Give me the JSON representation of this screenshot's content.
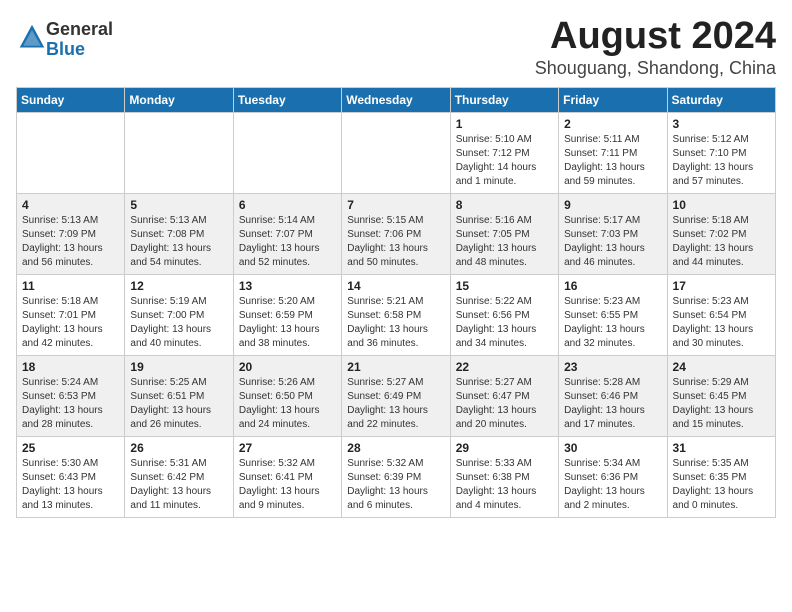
{
  "logo": {
    "general": "General",
    "blue": "Blue"
  },
  "title": "August 2024",
  "subtitle": "Shouguang, Shandong, China",
  "headers": [
    "Sunday",
    "Monday",
    "Tuesday",
    "Wednesday",
    "Thursday",
    "Friday",
    "Saturday"
  ],
  "weeks": [
    [
      {
        "day": "",
        "info": ""
      },
      {
        "day": "",
        "info": ""
      },
      {
        "day": "",
        "info": ""
      },
      {
        "day": "",
        "info": ""
      },
      {
        "day": "1",
        "info": "Sunrise: 5:10 AM\nSunset: 7:12 PM\nDaylight: 14 hours\nand 1 minute."
      },
      {
        "day": "2",
        "info": "Sunrise: 5:11 AM\nSunset: 7:11 PM\nDaylight: 13 hours\nand 59 minutes."
      },
      {
        "day": "3",
        "info": "Sunrise: 5:12 AM\nSunset: 7:10 PM\nDaylight: 13 hours\nand 57 minutes."
      }
    ],
    [
      {
        "day": "4",
        "info": "Sunrise: 5:13 AM\nSunset: 7:09 PM\nDaylight: 13 hours\nand 56 minutes."
      },
      {
        "day": "5",
        "info": "Sunrise: 5:13 AM\nSunset: 7:08 PM\nDaylight: 13 hours\nand 54 minutes."
      },
      {
        "day": "6",
        "info": "Sunrise: 5:14 AM\nSunset: 7:07 PM\nDaylight: 13 hours\nand 52 minutes."
      },
      {
        "day": "7",
        "info": "Sunrise: 5:15 AM\nSunset: 7:06 PM\nDaylight: 13 hours\nand 50 minutes."
      },
      {
        "day": "8",
        "info": "Sunrise: 5:16 AM\nSunset: 7:05 PM\nDaylight: 13 hours\nand 48 minutes."
      },
      {
        "day": "9",
        "info": "Sunrise: 5:17 AM\nSunset: 7:03 PM\nDaylight: 13 hours\nand 46 minutes."
      },
      {
        "day": "10",
        "info": "Sunrise: 5:18 AM\nSunset: 7:02 PM\nDaylight: 13 hours\nand 44 minutes."
      }
    ],
    [
      {
        "day": "11",
        "info": "Sunrise: 5:18 AM\nSunset: 7:01 PM\nDaylight: 13 hours\nand 42 minutes."
      },
      {
        "day": "12",
        "info": "Sunrise: 5:19 AM\nSunset: 7:00 PM\nDaylight: 13 hours\nand 40 minutes."
      },
      {
        "day": "13",
        "info": "Sunrise: 5:20 AM\nSunset: 6:59 PM\nDaylight: 13 hours\nand 38 minutes."
      },
      {
        "day": "14",
        "info": "Sunrise: 5:21 AM\nSunset: 6:58 PM\nDaylight: 13 hours\nand 36 minutes."
      },
      {
        "day": "15",
        "info": "Sunrise: 5:22 AM\nSunset: 6:56 PM\nDaylight: 13 hours\nand 34 minutes."
      },
      {
        "day": "16",
        "info": "Sunrise: 5:23 AM\nSunset: 6:55 PM\nDaylight: 13 hours\nand 32 minutes."
      },
      {
        "day": "17",
        "info": "Sunrise: 5:23 AM\nSunset: 6:54 PM\nDaylight: 13 hours\nand 30 minutes."
      }
    ],
    [
      {
        "day": "18",
        "info": "Sunrise: 5:24 AM\nSunset: 6:53 PM\nDaylight: 13 hours\nand 28 minutes."
      },
      {
        "day": "19",
        "info": "Sunrise: 5:25 AM\nSunset: 6:51 PM\nDaylight: 13 hours\nand 26 minutes."
      },
      {
        "day": "20",
        "info": "Sunrise: 5:26 AM\nSunset: 6:50 PM\nDaylight: 13 hours\nand 24 minutes."
      },
      {
        "day": "21",
        "info": "Sunrise: 5:27 AM\nSunset: 6:49 PM\nDaylight: 13 hours\nand 22 minutes."
      },
      {
        "day": "22",
        "info": "Sunrise: 5:27 AM\nSunset: 6:47 PM\nDaylight: 13 hours\nand 20 minutes."
      },
      {
        "day": "23",
        "info": "Sunrise: 5:28 AM\nSunset: 6:46 PM\nDaylight: 13 hours\nand 17 minutes."
      },
      {
        "day": "24",
        "info": "Sunrise: 5:29 AM\nSunset: 6:45 PM\nDaylight: 13 hours\nand 15 minutes."
      }
    ],
    [
      {
        "day": "25",
        "info": "Sunrise: 5:30 AM\nSunset: 6:43 PM\nDaylight: 13 hours\nand 13 minutes."
      },
      {
        "day": "26",
        "info": "Sunrise: 5:31 AM\nSunset: 6:42 PM\nDaylight: 13 hours\nand 11 minutes."
      },
      {
        "day": "27",
        "info": "Sunrise: 5:32 AM\nSunset: 6:41 PM\nDaylight: 13 hours\nand 9 minutes."
      },
      {
        "day": "28",
        "info": "Sunrise: 5:32 AM\nSunset: 6:39 PM\nDaylight: 13 hours\nand 6 minutes."
      },
      {
        "day": "29",
        "info": "Sunrise: 5:33 AM\nSunset: 6:38 PM\nDaylight: 13 hours\nand 4 minutes."
      },
      {
        "day": "30",
        "info": "Sunrise: 5:34 AM\nSunset: 6:36 PM\nDaylight: 13 hours\nand 2 minutes."
      },
      {
        "day": "31",
        "info": "Sunrise: 5:35 AM\nSunset: 6:35 PM\nDaylight: 13 hours\nand 0 minutes."
      }
    ]
  ]
}
